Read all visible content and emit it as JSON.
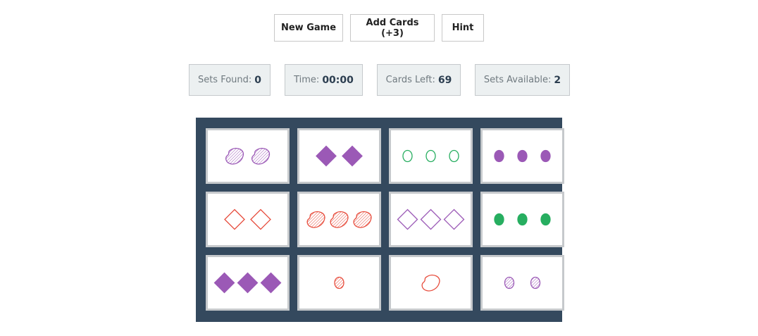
{
  "controls": {
    "new_game": "New Game",
    "add_cards": "Add Cards (+3)",
    "hint": "Hint"
  },
  "stats": {
    "sets_found_label": "Sets Found:",
    "sets_found": "0",
    "time_label": "Time:",
    "time": "00:00",
    "cards_left_label": "Cards Left:",
    "cards_left": "69",
    "sets_available_label": "Sets Available:",
    "sets_available": "2"
  },
  "colors": {
    "purple": "#9b59b6",
    "green": "#27ae60",
    "red": "#e74c3c",
    "board": "#34495e"
  },
  "cards": [
    {
      "count": 2,
      "shape": "squiggle",
      "color": "purple",
      "shading": "striped"
    },
    {
      "count": 2,
      "shape": "diamond",
      "color": "purple",
      "shading": "solid"
    },
    {
      "count": 3,
      "shape": "oval",
      "color": "green",
      "shading": "outline"
    },
    {
      "count": 3,
      "shape": "oval",
      "color": "purple",
      "shading": "solid"
    },
    {
      "count": 2,
      "shape": "diamond",
      "color": "red",
      "shading": "outline"
    },
    {
      "count": 3,
      "shape": "squiggle",
      "color": "red",
      "shading": "striped"
    },
    {
      "count": 3,
      "shape": "diamond",
      "color": "purple",
      "shading": "outline"
    },
    {
      "count": 3,
      "shape": "oval",
      "color": "green",
      "shading": "solid"
    },
    {
      "count": 3,
      "shape": "diamond",
      "color": "purple",
      "shading": "solid"
    },
    {
      "count": 1,
      "shape": "oval",
      "color": "red",
      "shading": "striped"
    },
    {
      "count": 1,
      "shape": "squiggle",
      "color": "red",
      "shading": "outline"
    },
    {
      "count": 2,
      "shape": "oval",
      "color": "purple",
      "shading": "striped"
    }
  ]
}
